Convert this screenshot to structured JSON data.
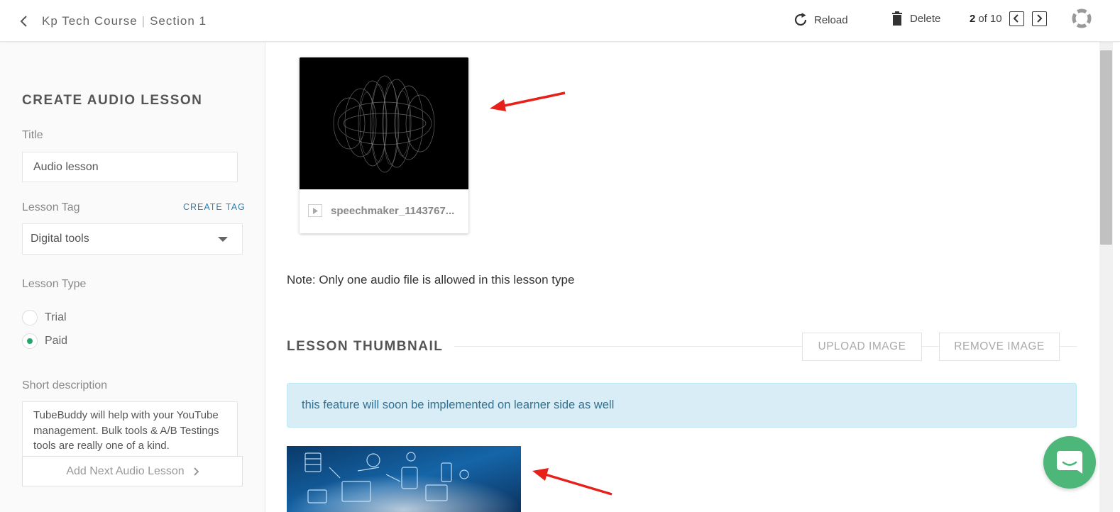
{
  "header": {
    "course_name": "Kp Tech Course",
    "section_name": "Section 1",
    "reload_label": "Reload",
    "delete_label": "Delete",
    "pager_current": "2",
    "pager_of": "of",
    "pager_total": "10"
  },
  "sidebar": {
    "heading": "CREATE AUDIO LESSON",
    "title_label": "Title",
    "title_value": "Audio lesson",
    "tag_label": "Lesson Tag",
    "create_tag_label": "CREATE TAG",
    "tag_value": "Digital tools",
    "type_label": "Lesson Type",
    "type_options": [
      "Trial",
      "Paid"
    ],
    "type_selected": "Paid",
    "description_label": "Short description",
    "description_value": "TubeBuddy will help with your YouTube management. Bulk tools & A/B Testings tools are really one of a kind.",
    "next_button_label": "Add Next Audio Lesson"
  },
  "main": {
    "audio_file_name": "speechmaker_1143767...",
    "note": "Note: Only one audio file is allowed in this lesson type",
    "thumbnail_heading": "LESSON THUMBNAIL",
    "upload_image_label": "UPLOAD IMAGE",
    "remove_image_label": "REMOVE IMAGE",
    "info_message": "this feature will soon be implemented on learner side as well"
  },
  "colors": {
    "accent_green": "#23a56b",
    "chat_green": "#4cb778",
    "link_blue": "#2f7fb5",
    "info_bg": "#d9edf7",
    "annotation_red": "#e8201a"
  }
}
